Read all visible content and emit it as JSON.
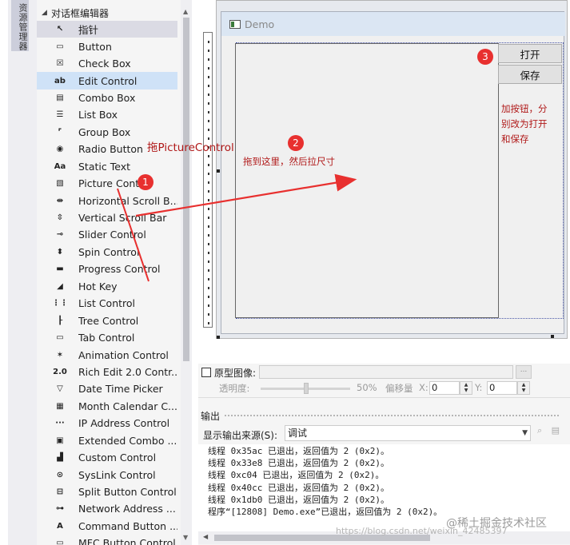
{
  "side_tab": "资源管理器",
  "toolbox": {
    "header": "对话框编辑器",
    "items": [
      {
        "label": "指针",
        "icon": "pointer-icon"
      },
      {
        "label": "Button",
        "icon": "button-icon"
      },
      {
        "label": "Check Box",
        "icon": "checkbox-icon"
      },
      {
        "label": "Edit Control",
        "icon": "edit-control-icon"
      },
      {
        "label": "Combo Box",
        "icon": "combobox-icon"
      },
      {
        "label": "List Box",
        "icon": "listbox-icon"
      },
      {
        "label": "Group Box",
        "icon": "groupbox-icon"
      },
      {
        "label": "Radio Button",
        "icon": "radio-icon"
      },
      {
        "label": "Static Text",
        "icon": "static-text-icon"
      },
      {
        "label": "Picture Control",
        "icon": "picture-icon"
      },
      {
        "label": "Horizontal Scroll B...",
        "icon": "hscroll-icon"
      },
      {
        "label": "Vertical Scroll Bar",
        "icon": "vscroll-icon"
      },
      {
        "label": "Slider Control",
        "icon": "slider-icon"
      },
      {
        "label": "Spin Control",
        "icon": "spin-icon"
      },
      {
        "label": "Progress Control",
        "icon": "progress-icon"
      },
      {
        "label": "Hot Key",
        "icon": "hotkey-icon"
      },
      {
        "label": "List Control",
        "icon": "list-control-icon"
      },
      {
        "label": "Tree Control",
        "icon": "tree-icon"
      },
      {
        "label": "Tab Control",
        "icon": "tab-icon"
      },
      {
        "label": "Animation Control",
        "icon": "animation-icon"
      },
      {
        "label": "Rich Edit 2.0 Contr...",
        "icon": "richedit-icon"
      },
      {
        "label": "Date Time Picker",
        "icon": "datetime-icon"
      },
      {
        "label": "Month Calendar C...",
        "icon": "calendar-icon"
      },
      {
        "label": "IP Address Control",
        "icon": "ip-icon"
      },
      {
        "label": "Extended Combo ...",
        "icon": "ext-combo-icon"
      },
      {
        "label": "Custom Control",
        "icon": "custom-icon"
      },
      {
        "label": "SysLink Control",
        "icon": "syslink-icon"
      },
      {
        "label": "Split Button Control",
        "icon": "split-button-icon"
      },
      {
        "label": "Network Address ...",
        "icon": "network-icon"
      },
      {
        "label": "Command Button ...",
        "icon": "command-icon"
      },
      {
        "label": "MFC Button Control",
        "icon": "mfc-button-icon"
      }
    ]
  },
  "dialog": {
    "title": "Demo",
    "buttons": {
      "open": "打开",
      "save": "保存"
    }
  },
  "annotations": {
    "badge1": "1",
    "badge2": "2",
    "badge3": "3",
    "drag_picture": "拖PictureControl",
    "drag_here": "拖到这里，然后拉尺寸",
    "add_buttons": "加按钮，分别改为打开和保存",
    "color": "#b01818"
  },
  "properties": {
    "prototype_image": "原型图像:",
    "transparency_label": "透明度:",
    "transparency_value": "50%",
    "offset_label": "偏移量",
    "x_label": "X:",
    "x_value": "0",
    "y_label": "Y:",
    "y_value": "0"
  },
  "output": {
    "title": "输出",
    "source_label": "显示输出来源(S):",
    "source_value": "调试",
    "lines": [
      "线程 0x35ac 已退出，返回值为 2 (0x2)。",
      "线程 0x33e8 已退出，返回值为 2 (0x2)。",
      "线程 0xc04 已退出，返回值为 2 (0x2)。",
      "线程 0x40cc 已退出，返回值为 2 (0x2)。",
      "线程 0x1db0 已退出，返回值为 2 (0x2)。",
      "程序“[12808] Demo.exe”已退出，返回值为 2 (0x2)。"
    ]
  },
  "watermark": "@稀土掘金技术社区",
  "watermark_url": "https://blog.csdn.net/weixin_42485397"
}
